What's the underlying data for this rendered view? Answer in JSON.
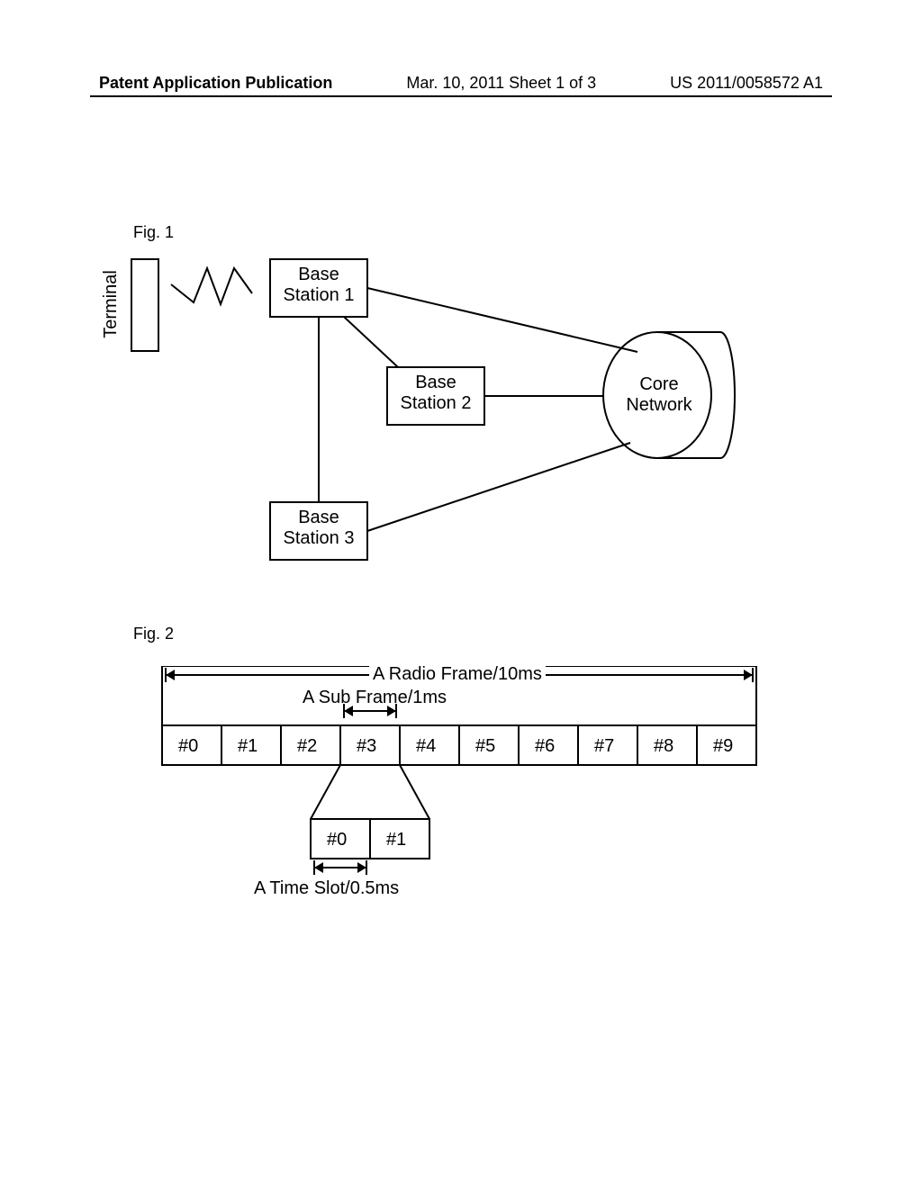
{
  "header": {
    "left": "Patent Application Publication",
    "center": "Mar. 10, 2011  Sheet 1 of 3",
    "right": "US 2011/0058572 A1"
  },
  "fig_labels": {
    "fig1": "Fig. 1",
    "fig2": "Fig. 2"
  },
  "fig1": {
    "terminal": "Terminal",
    "bs1_line1": "Base",
    "bs1_line2": "Station 1",
    "bs2_line1": "Base",
    "bs2_line2": "Station 2",
    "bs3_line1": "Base",
    "bs3_line2": "Station 3",
    "core_line1": "Core",
    "core_line2": "Network"
  },
  "fig2": {
    "radio_frame": "A Radio Frame/10ms",
    "sub_frame": "A Sub Frame/1ms",
    "time_slot": "A Time Slot/0.5ms",
    "subframes": [
      "#0",
      "#1",
      "#2",
      "#3",
      "#4",
      "#5",
      "#6",
      "#7",
      "#8",
      "#9"
    ],
    "slots": [
      "#0",
      "#1"
    ]
  }
}
